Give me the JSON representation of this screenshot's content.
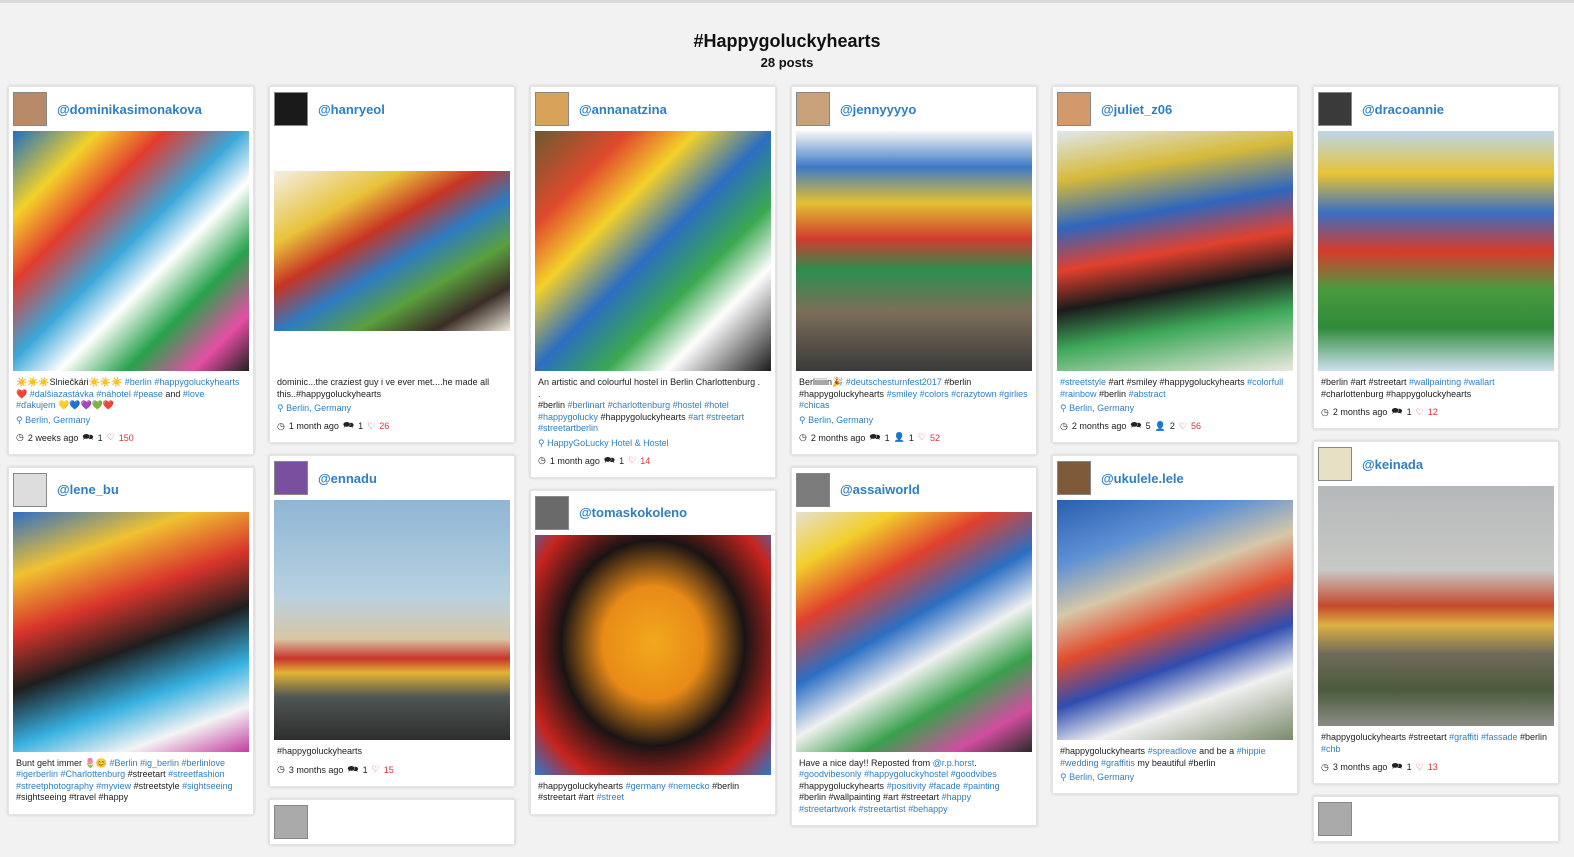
{
  "page": {
    "title": "#Happygoluckyhearts",
    "post_count": "28 posts"
  },
  "icons": {
    "clock": "clock-icon",
    "comment": "comment-icon",
    "heart": "heart-icon",
    "location": "location-pin-icon",
    "user": "user-icon"
  },
  "colors": {
    "link": "#2f7fc1",
    "heart": "#e0313b"
  },
  "columns": [
    [
      {
        "user": "@dominikasimonakova",
        "caption_html": "☀️☀️☀️Slniečkári☀️☀️☀️ <span class='tag'>#berlin</span> <span class='tag'>#happygoluckyhearts</span> ❤️ <span class='tag'>#dalšiazastávka</span> <span class='tag'>#náhotel</span> <span class='tag'>#pease</span> and <span class='tag'>#love</span> <span class='tag'>#ďakujem</span> 💛💙💜💚❤️",
        "location": "Berlin, Germany",
        "time": "2 weeks ago",
        "comments": "1",
        "likes": "150"
      },
      {
        "user": "@lene_bu",
        "caption_html": "Bunt geht immer 🌷😊 <span class='tag'>#Berlin</span> <span class='tag'>#ig_berlin</span> <span class='tag'>#berlinlove</span> <span class='tag'>#igerberlin</span> <span class='tag'>#Charlottenburg</span> #streetart <span class='tag'>#streetfashion</span> <span class='tag'>#streetphotography</span> <span class='tag'>#myview</span> #streetstyle <span class='tag'>#sightseeing</span> #sightseeing #travel #happy"
      }
    ],
    [
      {
        "user": "@hanryeol",
        "caption_html": "dominic...the craziest guy i ve ever met....he made all this..#happygoluckyhearts",
        "location": "Berlin, Germany",
        "time": "1 month ago",
        "comments": "1",
        "likes": "26"
      },
      {
        "user": "@ennadu",
        "caption_html": "#happygoluckyhearts",
        "time": "3 months ago",
        "comments": "1",
        "likes": "15"
      },
      {
        "user": ""
      }
    ],
    [
      {
        "user": "@annanatzina",
        "caption_html": "An artistic and colourful hostel in Berlin Charlottenburg .<br>.<br>#berlin <span class='tag'>#berlinart</span> <span class='tag'>#charlottenburg</span> <span class='tag'>#hostel</span> <span class='tag'>#hotel</span> <span class='tag'>#happygolucky</span> #happygoluckyhearts <span class='tag'>#art</span> <span class='tag'>#streetart</span> <span class='tag'>#streetartberlin</span>",
        "location": "HappyGoLucky Hotel &amp; Hostel",
        "time": "1 month ago",
        "comments": "1",
        "likes": "14"
      },
      {
        "user": "@tomaskokoleno",
        "caption_html": "#happygoluckyhearts <span class='tag'>#germany</span> <span class='tag'>#nemecko</span> #berlin #streetart #art <span class='tag'>#street</span>"
      }
    ],
    [
      {
        "user": "@jennyyyyo",
        "caption_html": "Berliiiiiin🎉 <span class='tag'>#deutschesturnfest2017</span> #berlin #happygoluckyhearts <span class='tag'>#smiley</span> <span class='tag'>#colors</span> <span class='tag'>#crazytown</span> <span class='tag'>#girlies</span> <span class='tag'>#chicas</span>",
        "location": "Berlin, Germany",
        "time": "2 months ago",
        "comments": "1",
        "users": "1",
        "likes": "52"
      },
      {
        "user": "@assaiworld",
        "caption_html": "Have a nice day!! Reposted from <span class='tag'>@r.p.horst</span>. <span class='tag'>#goodvibesonly</span> <span class='tag'>#happygoluckyhostel</span> <span class='tag'>#goodvibes</span> #happygoluckyhearts <span class='tag'>#positivity</span> <span class='tag'>#facade</span> <span class='tag'>#painting</span> #berlin #wallpainting #art #streetart <span class='tag'>#happy</span> <span class='tag'>#streetartwork</span> <span class='tag'>#streetartist</span> <span class='tag'>#behappy</span>"
      }
    ],
    [
      {
        "user": "@juliet_z06",
        "caption_html": "<span class='tag'>#streetstyle</span> #art #smiley #happygoluckyhearts <span class='tag'>#colorfull</span> <span class='tag'>#rainbow</span> #berlin <span class='tag'>#abstract</span>",
        "location": "Berlin, Germany",
        "time": "2 months ago",
        "comments": "5",
        "users": "2",
        "likes": "56"
      },
      {
        "user": "@ukulele.lele",
        "caption_html": "#happygoluckyhearts <span class='tag'>#spreadlove</span> and be a <span class='tag'>#hippie</span> <span class='tag'>#wedding</span> <span class='tag'>#graffitis</span> my beautiful #berlin",
        "location": "Berlin, Germany"
      }
    ],
    [
      {
        "user": "@dracoannie",
        "caption_html": "#berlin #art #streetart <span class='tag'>#wallpainting</span> <span class='tag'>#wallart</span> #charlottenburg #happygoluckyhearts",
        "time": "2 months ago",
        "comments": "1",
        "likes": "12"
      },
      {
        "user": "@keinada",
        "caption_html": "#happygoluckyhearts #streetart <span class='tag'>#graffiti</span> <span class='tag'>#fassade</span> #berlin <span class='tag'>#chb</span>",
        "time": "3 months ago",
        "comments": "1",
        "likes": "13"
      },
      {
        "user": ""
      }
    ]
  ]
}
